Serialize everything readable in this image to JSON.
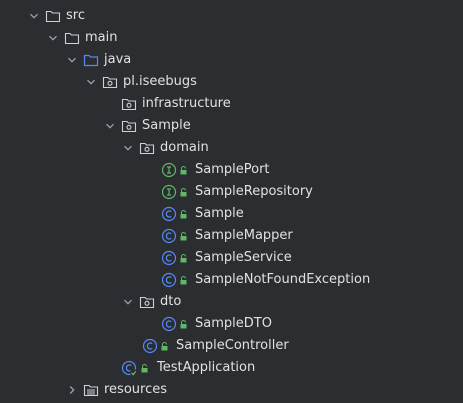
{
  "tree": {
    "src": {
      "label": "src",
      "icon": "folder-icon"
    },
    "main": {
      "label": "main",
      "icon": "folder-icon"
    },
    "java": {
      "label": "java",
      "icon": "source-root-folder-icon"
    },
    "pl_iseebugs": {
      "label": "pl.iseebugs",
      "icon": "package-icon"
    },
    "infrastructure": {
      "label": "infrastructure",
      "icon": "package-icon"
    },
    "sample": {
      "label": "Sample",
      "icon": "package-icon"
    },
    "domain": {
      "label": "domain",
      "icon": "package-icon"
    },
    "sample_port": {
      "label": "SamplePort",
      "icon": "interface-icon"
    },
    "sample_repository": {
      "label": "SampleRepository",
      "icon": "interface-icon"
    },
    "sample_class": {
      "label": "Sample",
      "icon": "class-icon"
    },
    "sample_mapper": {
      "label": "SampleMapper",
      "icon": "class-icon"
    },
    "sample_service": {
      "label": "SampleService",
      "icon": "class-icon"
    },
    "sample_not_found": {
      "label": "SampleNotFoundException",
      "icon": "class-icon"
    },
    "dto": {
      "label": "dto",
      "icon": "package-icon"
    },
    "sample_dto": {
      "label": "SampleDTO",
      "icon": "class-icon"
    },
    "sample_controller": {
      "label": "SampleController",
      "icon": "class-icon"
    },
    "test_application": {
      "label": "TestApplication",
      "icon": "spring-boot-class-icon"
    },
    "resources": {
      "label": "resources",
      "icon": "resources-folder-icon"
    }
  },
  "colors": {
    "background": "#2b2d30",
    "text": "#dfe1e5",
    "chevron": "#9da0a8",
    "folder_stroke": "#ced0d6",
    "source_folder": "#548af7",
    "class_icon": "#548af7",
    "interface_icon": "#5fb865",
    "access_lock": "#5fb865"
  }
}
